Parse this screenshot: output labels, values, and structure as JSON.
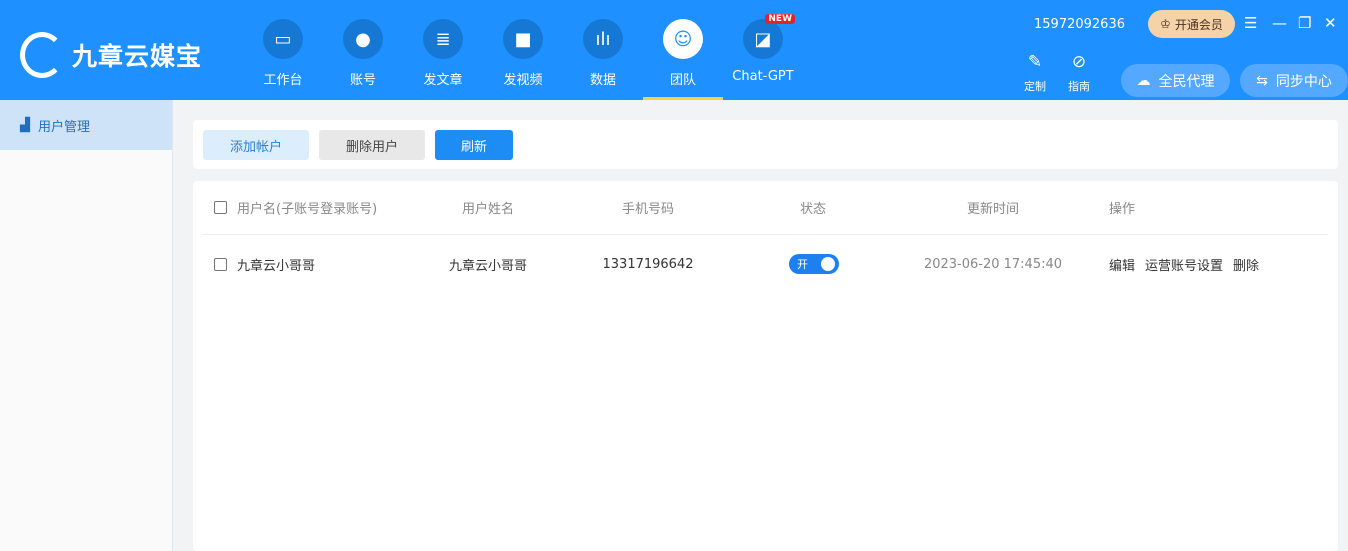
{
  "app": {
    "name": "九章云媒宝"
  },
  "nav": [
    {
      "label": "工作台",
      "icon": "monitor-icon",
      "glyph": "▭"
    },
    {
      "label": "账号",
      "icon": "user-icon",
      "glyph": "●"
    },
    {
      "label": "发文章",
      "icon": "document-icon",
      "glyph": "≣"
    },
    {
      "label": "发视频",
      "icon": "video-icon",
      "glyph": "■"
    },
    {
      "label": "数据",
      "icon": "bar-chart-icon",
      "glyph": "ılı"
    },
    {
      "label": "团队",
      "icon": "team-icon",
      "glyph": "☺"
    },
    {
      "label": "Chat-GPT",
      "icon": "chat-gpt-icon",
      "glyph": "◪",
      "badge": "NEW"
    }
  ],
  "header": {
    "phone": "15972092636",
    "vip": "开通会员",
    "customize": "定制",
    "guide": "指南",
    "agent": "全民代理",
    "sync": "同步中心"
  },
  "sidebar": {
    "items": [
      {
        "label": "用户管理"
      }
    ]
  },
  "toolbar": {
    "add": "添加帐户",
    "delete": "删除用户",
    "refresh": "刷新"
  },
  "table": {
    "columns": [
      "用户名(子账号登录账号)",
      "用户姓名",
      "手机号码",
      "状态",
      "更新时间",
      "操作"
    ],
    "rows": [
      {
        "username": "九章云小哥哥",
        "name": "九章云小哥哥",
        "phone": "13317196642",
        "status": "开",
        "status_on": true,
        "updated": "2023-06-20 17:45:40",
        "actions": [
          "编辑",
          "运营账号设置",
          "删除"
        ]
      }
    ]
  },
  "colors": {
    "brand": "#1e90ff",
    "active_underline": "#f5d442"
  }
}
